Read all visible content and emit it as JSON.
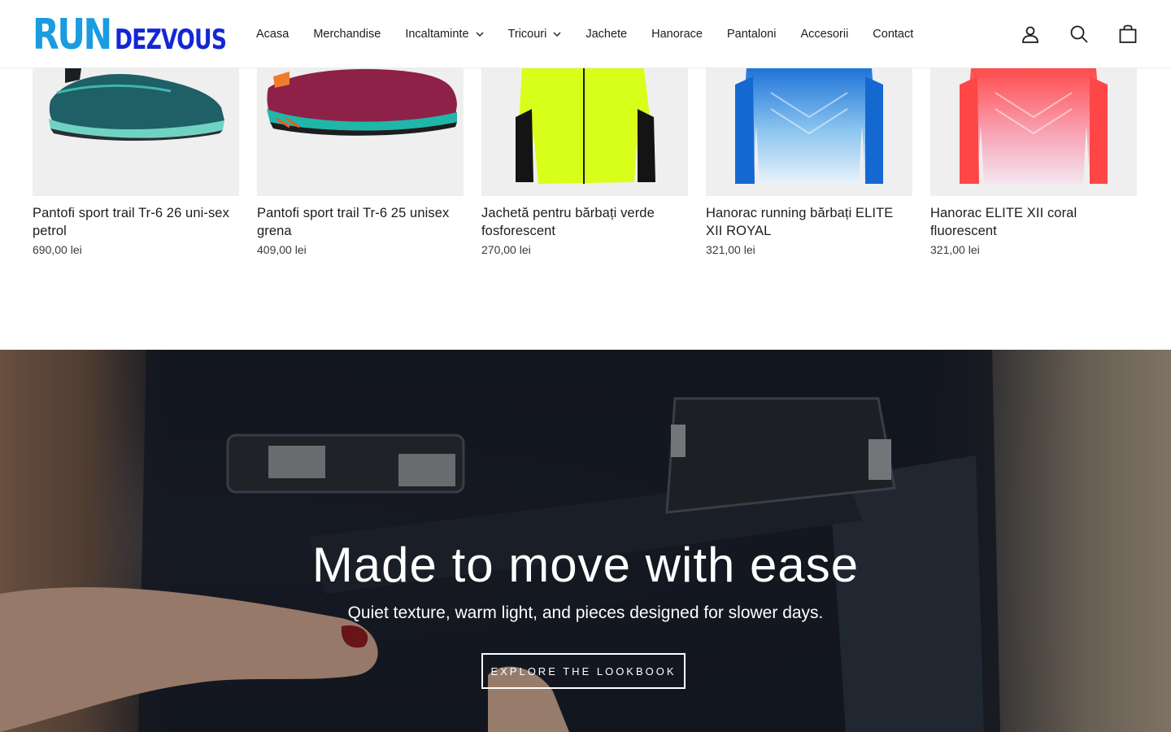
{
  "brand": {
    "logo_part1": "RUN",
    "logo_part2": "DEZVOUS",
    "colors": {
      "run": "#1b9be0",
      "dezvous": "#1427d6"
    }
  },
  "nav": {
    "items": [
      {
        "label": "Acasa",
        "dropdown": false
      },
      {
        "label": "Merchandise",
        "dropdown": false
      },
      {
        "label": "Incaltaminte",
        "dropdown": true
      },
      {
        "label": "Tricouri",
        "dropdown": true
      },
      {
        "label": "Jachete",
        "dropdown": false
      },
      {
        "label": "Hanorace",
        "dropdown": false
      },
      {
        "label": "Pantaloni",
        "dropdown": false
      },
      {
        "label": "Accesorii",
        "dropdown": false
      },
      {
        "label": "Contact",
        "dropdown": false
      }
    ]
  },
  "header_icons": [
    "account-icon",
    "search-icon",
    "cart-icon"
  ],
  "products": [
    {
      "title": "Pantofi sport trail Tr-6 26 uni-sex petrol",
      "price": "690,00 lei",
      "image": "teal-trail-shoe"
    },
    {
      "title": "Pantofi sport trail Tr-6 25 unisex grena",
      "price": "409,00 lei",
      "image": "burgundy-trail-shoe"
    },
    {
      "title": "Jachetă pentru bărbați verde fosforescent",
      "price": "270,00 lei",
      "image": "neon-green-jacket"
    },
    {
      "title": "Hanorac running bărbați ELITE XII ROYAL",
      "price": "321,00 lei",
      "image": "blue-running-top"
    },
    {
      "title": "Hanorac ELITE XII coral fluorescent",
      "price": "321,00 lei",
      "image": "coral-running-top"
    }
  ],
  "hero": {
    "title": "Made to move with ease",
    "subtitle": "Quiet texture, warm light, and pieces designed for slower days.",
    "button_label": "EXPLORE THE LOOKBOOK"
  }
}
